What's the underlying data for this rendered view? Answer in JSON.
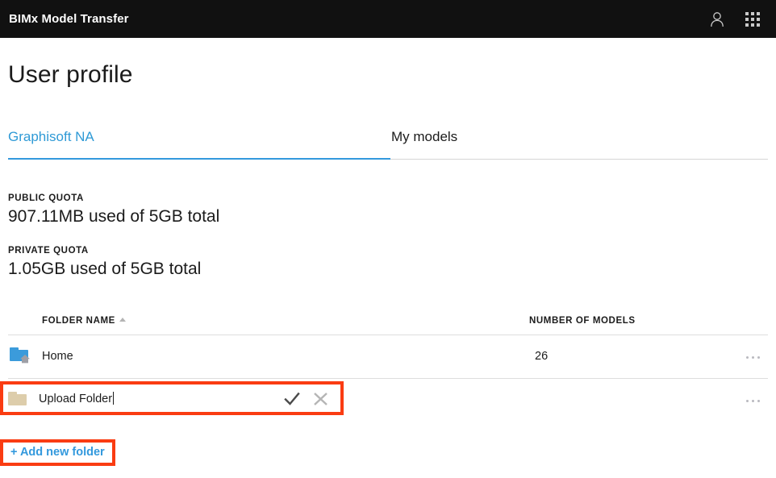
{
  "topbar": {
    "title": "BIMx Model Transfer",
    "account_icon": "user-icon",
    "apps_icon": "apps-grid-icon"
  },
  "page": {
    "title": "User profile"
  },
  "tabs": [
    {
      "label": "Graphisoft NA",
      "active": true
    },
    {
      "label": "My models",
      "active": false
    }
  ],
  "quotas": [
    {
      "label": "PUBLIC QUOTA",
      "value": "907.11MB used of 5GB total"
    },
    {
      "label": "PRIVATE QUOTA",
      "value": "1.05GB used of 5GB total"
    }
  ],
  "table": {
    "headers": {
      "folder_name": "FOLDER NAME",
      "number_of_models": "NUMBER OF MODELS",
      "sort_direction": "ascending"
    },
    "rows": [
      {
        "name": "Home",
        "count": "26",
        "icon": "folder-home-icon",
        "menu": "overflow-menu-icon"
      }
    ],
    "editing_row": {
      "value": "Upload Folder",
      "placeholder": "Folder name",
      "icon": "folder-icon",
      "confirm_icon": "check-icon",
      "cancel_icon": "close-icon",
      "menu": "overflow-menu-icon"
    }
  },
  "actions": {
    "add_new_folder": "+ Add new folder"
  },
  "colors": {
    "topbar_background": "#111111",
    "accent_blue": "#3399dd",
    "tab_active_text": "#2f9ad6",
    "folder_blue": "#3b9bdb",
    "folder_tan": "#ddcdab",
    "annotation_red": "#fa3c12",
    "divider": "#dedede"
  }
}
